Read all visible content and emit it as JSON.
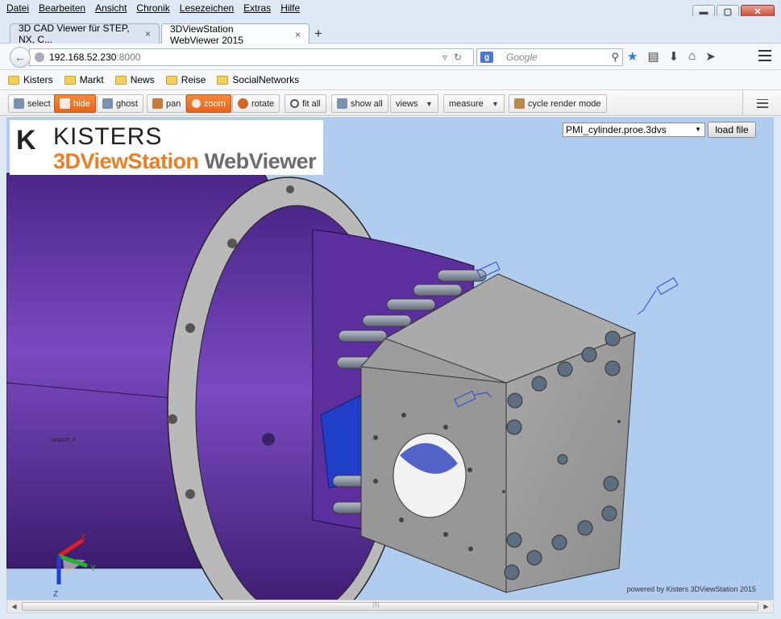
{
  "menu": [
    "Datei",
    "Bearbeiten",
    "Ansicht",
    "Chronik",
    "Lesezeichen",
    "Extras",
    "Hilfe"
  ],
  "window_buttons": {
    "minimize": "▬",
    "maximize": "▢",
    "close": "✕"
  },
  "tabs": [
    {
      "label": "3D CAD Viewer für STEP, NX, C...",
      "close": "×"
    },
    {
      "label": "3DViewStation WebViewer 2015",
      "close": "×"
    }
  ],
  "new_tab": "+",
  "address": {
    "host": "192.168.52.230",
    "port": ":8000"
  },
  "search": {
    "engine_icon": "g",
    "placeholder": "Google"
  },
  "bookmarks": [
    "Kisters",
    "Markt",
    "News",
    "Reise",
    "SocialNetworks"
  ],
  "toolbar": {
    "select": "select",
    "hide": "hide",
    "ghost": "ghost",
    "pan": "pan",
    "zoom": "zoom",
    "rotate": "rotate",
    "fit_all": "fit all",
    "show_all": "show all",
    "views": "views",
    "measure": "measure",
    "cycle_render_mode": "cycle render mode"
  },
  "logo": {
    "brand": "KISTERS",
    "product_orange": "3DViewStation",
    "product_gray": "WebViewer"
  },
  "model_select": {
    "value": "PMI_cylinder.proe.3dvs"
  },
  "load_file": "load file",
  "pmi_label": "MINDER_P",
  "axes": {
    "x": "X",
    "y": "Y",
    "z": "Z"
  },
  "powered_by": "powered by Kisters 3DViewStation 2015",
  "colors": {
    "accent": "#ef7d22",
    "viewport_bg": "#b0cdef",
    "cylinder": "#6a3aa8",
    "block": "#9a9a9a"
  }
}
